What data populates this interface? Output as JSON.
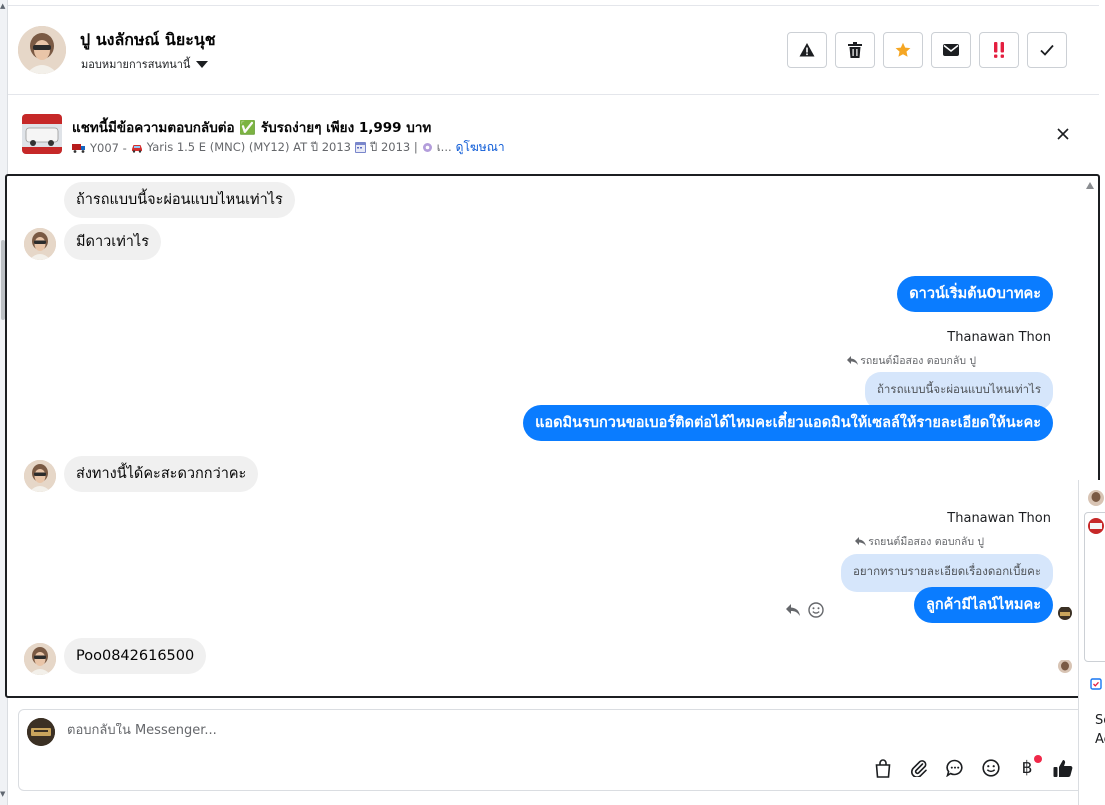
{
  "header": {
    "contact_name": "ปู นงลักษณ์ นิยะนุช",
    "assign_label": "มอบหมายการสนทนานี้",
    "actions": [
      {
        "name": "report-spam-button",
        "icon": "warning-icon"
      },
      {
        "name": "delete-button",
        "icon": "trash-icon"
      },
      {
        "name": "star-button",
        "icon": "star-icon"
      },
      {
        "name": "mark-unread-button",
        "icon": "envelope-icon"
      },
      {
        "name": "follow-up-button",
        "icon": "exclamation-icon"
      },
      {
        "name": "mark-done-button",
        "icon": "check-icon"
      }
    ]
  },
  "ad": {
    "title": "แชทนี้มีข้อความตอบกลับต่อ ✅ รับรถง่ายๆ เพียง 1,999 บาท",
    "meta_id": "Y007 -",
    "meta_model": "Yaris 1.5 E (MNC) (MY12) AT ปี 2013",
    "meta_year": "ปี 2013 |",
    "meta_more": "เ...",
    "link": "ดูโฆษณา"
  },
  "messages": {
    "m1": "ถ้ารถแบบนี้จะผ่อนแบบไหนเท่าไร",
    "m2": "มีดาวเท่าไร",
    "m3": "ดาวน์เริ่มต้น0บาทคะ",
    "m4_sender": "Thanawan Thon",
    "m4_note": "รถยนต์มือสอง ตอบกลับ ปู",
    "m4_quote": "ถ้ารถแบบนี้จะผ่อนแบบไหนเท่าไร",
    "m4_text": "แอดมินรบกวนขอเบอร์ติดต่อได้ไหมคะเดี๋ยวแอดมินให้เซลล์ให้รายละเอียดให้นะคะ",
    "m5": "ส่งทางนี้ได้คะสะดวกกว่าคะ",
    "m6_sender": "Thanawan Thon",
    "m6_note": "รถยนต์มือสอง ตอบกลับ ปู",
    "m6_quote": "อยากทราบรายละเอียดเรื่องดอกเบี้ยคะ",
    "m6_text": "ลูกค้ามีไลน์ไหมคะ",
    "m7": "Poo0842616500"
  },
  "composer": {
    "placeholder": "ตอบกลับใน Messenger...",
    "baht_symbol": "฿"
  },
  "right_panel": {
    "text_a": "Sc",
    "text_b": "Ac"
  },
  "colors": {
    "outgoing": "#0a7cff",
    "incoming": "#f0f0f0",
    "quote": "#d6e6fb",
    "link": "#0d5bd7",
    "star": "#f5a623",
    "alert": "#e41e3f"
  }
}
